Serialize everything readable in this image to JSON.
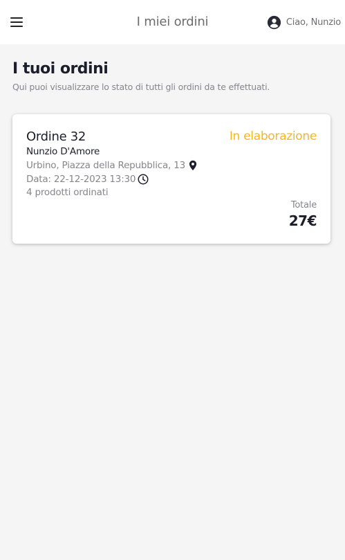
{
  "header": {
    "menu_icon": "menu-icon",
    "title": "I miei ordini",
    "user_icon": "account-circle-icon",
    "greeting": "Ciao, Nunzio"
  },
  "page": {
    "title": "I tuoi ordini",
    "subtitle": "Qui puoi visualizzare lo stato di tutti gli ordini da te effettuati."
  },
  "orders": [
    {
      "title": "Ordine 32",
      "status": "In elaborazione",
      "customer": "Nunzio D'Amore",
      "address": "Urbino, Piazza della Repubblica, 13",
      "address_icon": "location-pin-icon",
      "date": "Data: 22-12-2023 13:30",
      "date_icon": "clock-icon",
      "products": "4 prodotti ordinati",
      "total_label": "Totale",
      "total": "27€"
    }
  ],
  "colors": {
    "status_processing": "#f5b81c",
    "background": "#f5f5f5",
    "text_primary": "#1d1d2c",
    "text_secondary": "#85858c"
  }
}
